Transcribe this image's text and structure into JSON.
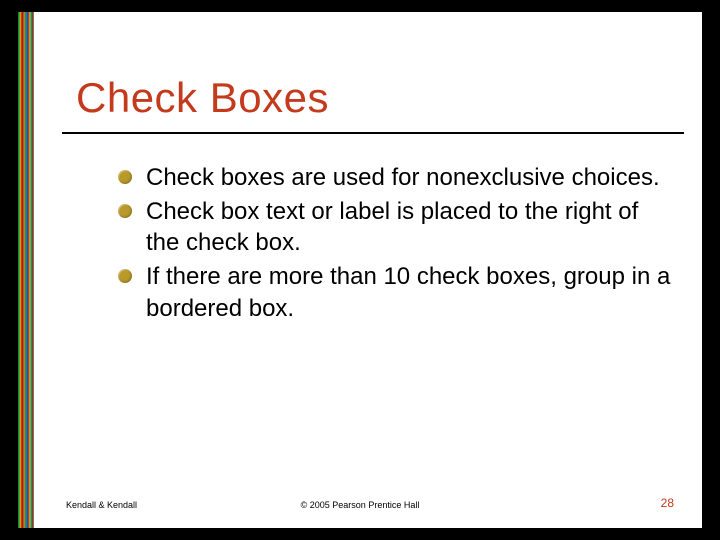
{
  "slide": {
    "title": "Check Boxes",
    "bullets": [
      "Check boxes are used for nonexclusive choices.",
      "Check box text or label is placed to the right of the check box.",
      "If there are more than 10 check boxes, group in a bordered box."
    ],
    "footer": {
      "left": "Kendall & Kendall",
      "center": "© 2005 Pearson Prentice Hall",
      "page": "28"
    }
  }
}
